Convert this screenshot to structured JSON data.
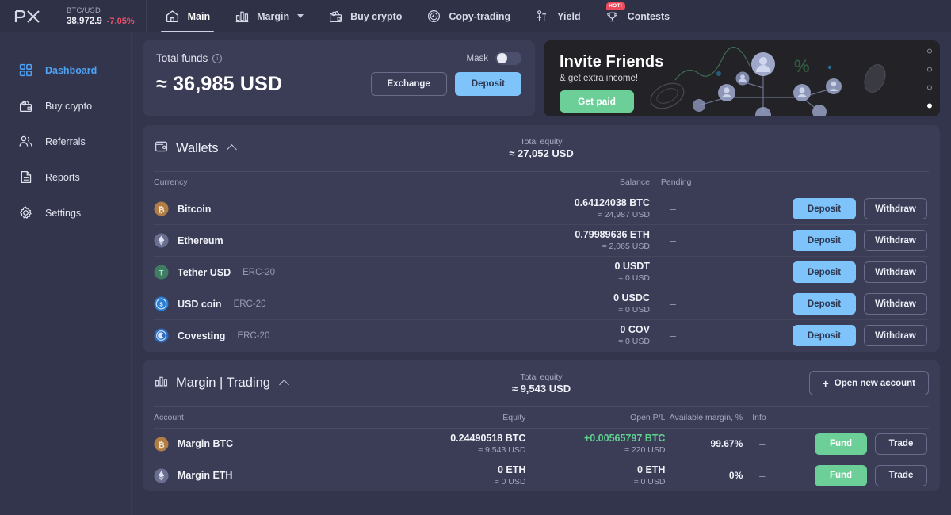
{
  "topbar": {
    "logo": "px-logo",
    "ticker": {
      "pair": "BTC/USD",
      "price": "38,972.9",
      "change": "-7.05%",
      "change_color": "#e8516a"
    },
    "nav": [
      {
        "label": "Main",
        "icon": "home-icon",
        "active": true,
        "caret": false,
        "badge": null
      },
      {
        "label": "Margin",
        "icon": "bar-chart-icon",
        "active": false,
        "caret": true,
        "badge": null
      },
      {
        "label": "Buy crypto",
        "icon": "buy-crypto-icon",
        "active": false,
        "caret": false,
        "badge": null
      },
      {
        "label": "Copy-trading",
        "icon": "copy-trading-icon",
        "active": false,
        "caret": false,
        "badge": null
      },
      {
        "label": "Yield",
        "icon": "yield-icon",
        "active": false,
        "caret": false,
        "badge": null
      },
      {
        "label": "Contests",
        "icon": "contests-icon",
        "active": false,
        "caret": false,
        "badge": "HOT!"
      }
    ]
  },
  "sidebar": {
    "items": [
      {
        "label": "Dashboard",
        "icon": "grid-icon",
        "active": true
      },
      {
        "label": "Buy crypto",
        "icon": "buy-crypto-icon",
        "active": false
      },
      {
        "label": "Referrals",
        "icon": "users-icon",
        "active": false
      },
      {
        "label": "Reports",
        "icon": "document-icon",
        "active": false
      },
      {
        "label": "Settings",
        "icon": "gear-icon",
        "active": false
      }
    ]
  },
  "total_funds": {
    "title": "Total funds",
    "info_icon": "info-icon",
    "mask_label": "Mask",
    "mask_on": false,
    "amount": "≈ 36,985 USD",
    "exchange_label": "Exchange",
    "deposit_label": "Deposit",
    "accent": "#7ec4fb"
  },
  "invite_banner": {
    "title": "Invite Friends",
    "subtitle": "& get extra income!",
    "cta_label": "Get paid",
    "cta_color": "#6bcf97",
    "dots": 4,
    "active_dot": 4
  },
  "wallets": {
    "title": "Wallets",
    "icon": "wallet-icon",
    "collapse_icon": "chevron-up-icon",
    "equity_label": "Total equity",
    "equity_value": "≈ 27,052 USD",
    "columns": [
      "Currency",
      "Balance",
      "Pending",
      ""
    ],
    "rows": [
      {
        "name": "Bitcoin",
        "network": "",
        "icon": "bitcoin-icon",
        "color": "#b07d45",
        "balance": "0.64124038 BTC",
        "balance_usd": "≈ 24,987 USD",
        "pending": "–",
        "deposit_label": "Deposit",
        "withdraw_label": "Withdraw"
      },
      {
        "name": "Ethereum",
        "network": "",
        "icon": "ethereum-icon",
        "color": "#6b6f8f",
        "balance": "0.79989636 ETH",
        "balance_usd": "≈ 2,065 USD",
        "pending": "–",
        "deposit_label": "Deposit",
        "withdraw_label": "Withdraw"
      },
      {
        "name": "Tether USD",
        "network": "ERC-20",
        "icon": "tether-icon",
        "color": "#3f7d62",
        "balance": "0 USDT",
        "balance_usd": "≈ 0 USD",
        "pending": "–",
        "deposit_label": "Deposit",
        "withdraw_label": "Withdraw"
      },
      {
        "name": "USD coin",
        "network": "ERC-20",
        "icon": "usdc-icon",
        "color": "#2a7fd4",
        "balance": "0 USDC",
        "balance_usd": "≈ 0 USD",
        "pending": "–",
        "deposit_label": "Deposit",
        "withdraw_label": "Withdraw"
      },
      {
        "name": "Covesting",
        "network": "ERC-20",
        "icon": "covesting-icon",
        "color": "#2f6bbd",
        "balance": "0 COV",
        "balance_usd": "≈ 0 USD",
        "pending": "–",
        "deposit_label": "Deposit",
        "withdraw_label": "Withdraw"
      }
    ]
  },
  "margin": {
    "title": "Margin | Trading",
    "icon": "bar-chart-icon",
    "collapse_icon": "chevron-up-icon",
    "equity_label": "Total equity",
    "equity_value": "≈ 9,543 USD",
    "open_account_label": "Open new account",
    "columns": [
      "Account",
      "Equity",
      "Open P/L",
      "Available margin, %",
      "Info",
      ""
    ],
    "rows": [
      {
        "name": "Margin BTC",
        "icon": "bitcoin-icon",
        "color": "#b07d45",
        "equity": "0.24490518 BTC",
        "equity_usd": "≈ 9,543 USD",
        "pl": "+0.00565797 BTC",
        "pl_usd": "≈ 220 USD",
        "pl_positive": true,
        "available_margin": "99.67%",
        "info": "–",
        "fund_label": "Fund",
        "trade_label": "Trade"
      },
      {
        "name": "Margin ETH",
        "icon": "ethereum-icon",
        "color": "#6b6f8f",
        "equity": "0 ETH",
        "equity_usd": "≈ 0 USD",
        "pl": "0 ETH",
        "pl_usd": "≈ 0 USD",
        "pl_positive": false,
        "available_margin": "0%",
        "info": "–",
        "fund_label": "Fund",
        "trade_label": "Trade"
      }
    ]
  }
}
